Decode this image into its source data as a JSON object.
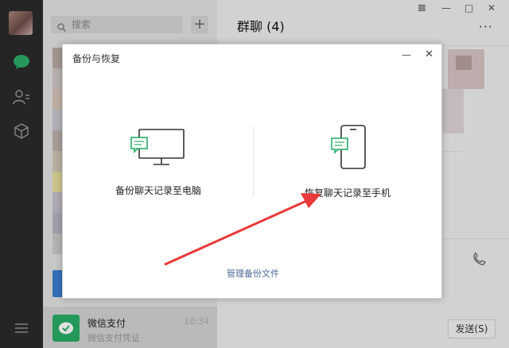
{
  "search": {
    "placeholder": "搜索"
  },
  "chat_list": {
    "pay_item": {
      "title": "微信支付",
      "subtitle": "微信支付凭证",
      "time": "10:34"
    }
  },
  "chat": {
    "title": "群聊 (4)",
    "send_label": "发送(S)",
    "more": "···"
  },
  "window_controls": {
    "pin": "𝌆",
    "minimize": "—",
    "maximize": "□",
    "close": "✕"
  },
  "dialog": {
    "title": "备份与恢复",
    "minimize": "—",
    "close": "✕",
    "backup_label": "备份聊天记录至电脑",
    "restore_label": "恢复聊天记录至手机",
    "manage_link": "管理备份文件"
  },
  "colors": {
    "accent_green": "#2aae67",
    "arrow_red": "#e83a3a"
  }
}
